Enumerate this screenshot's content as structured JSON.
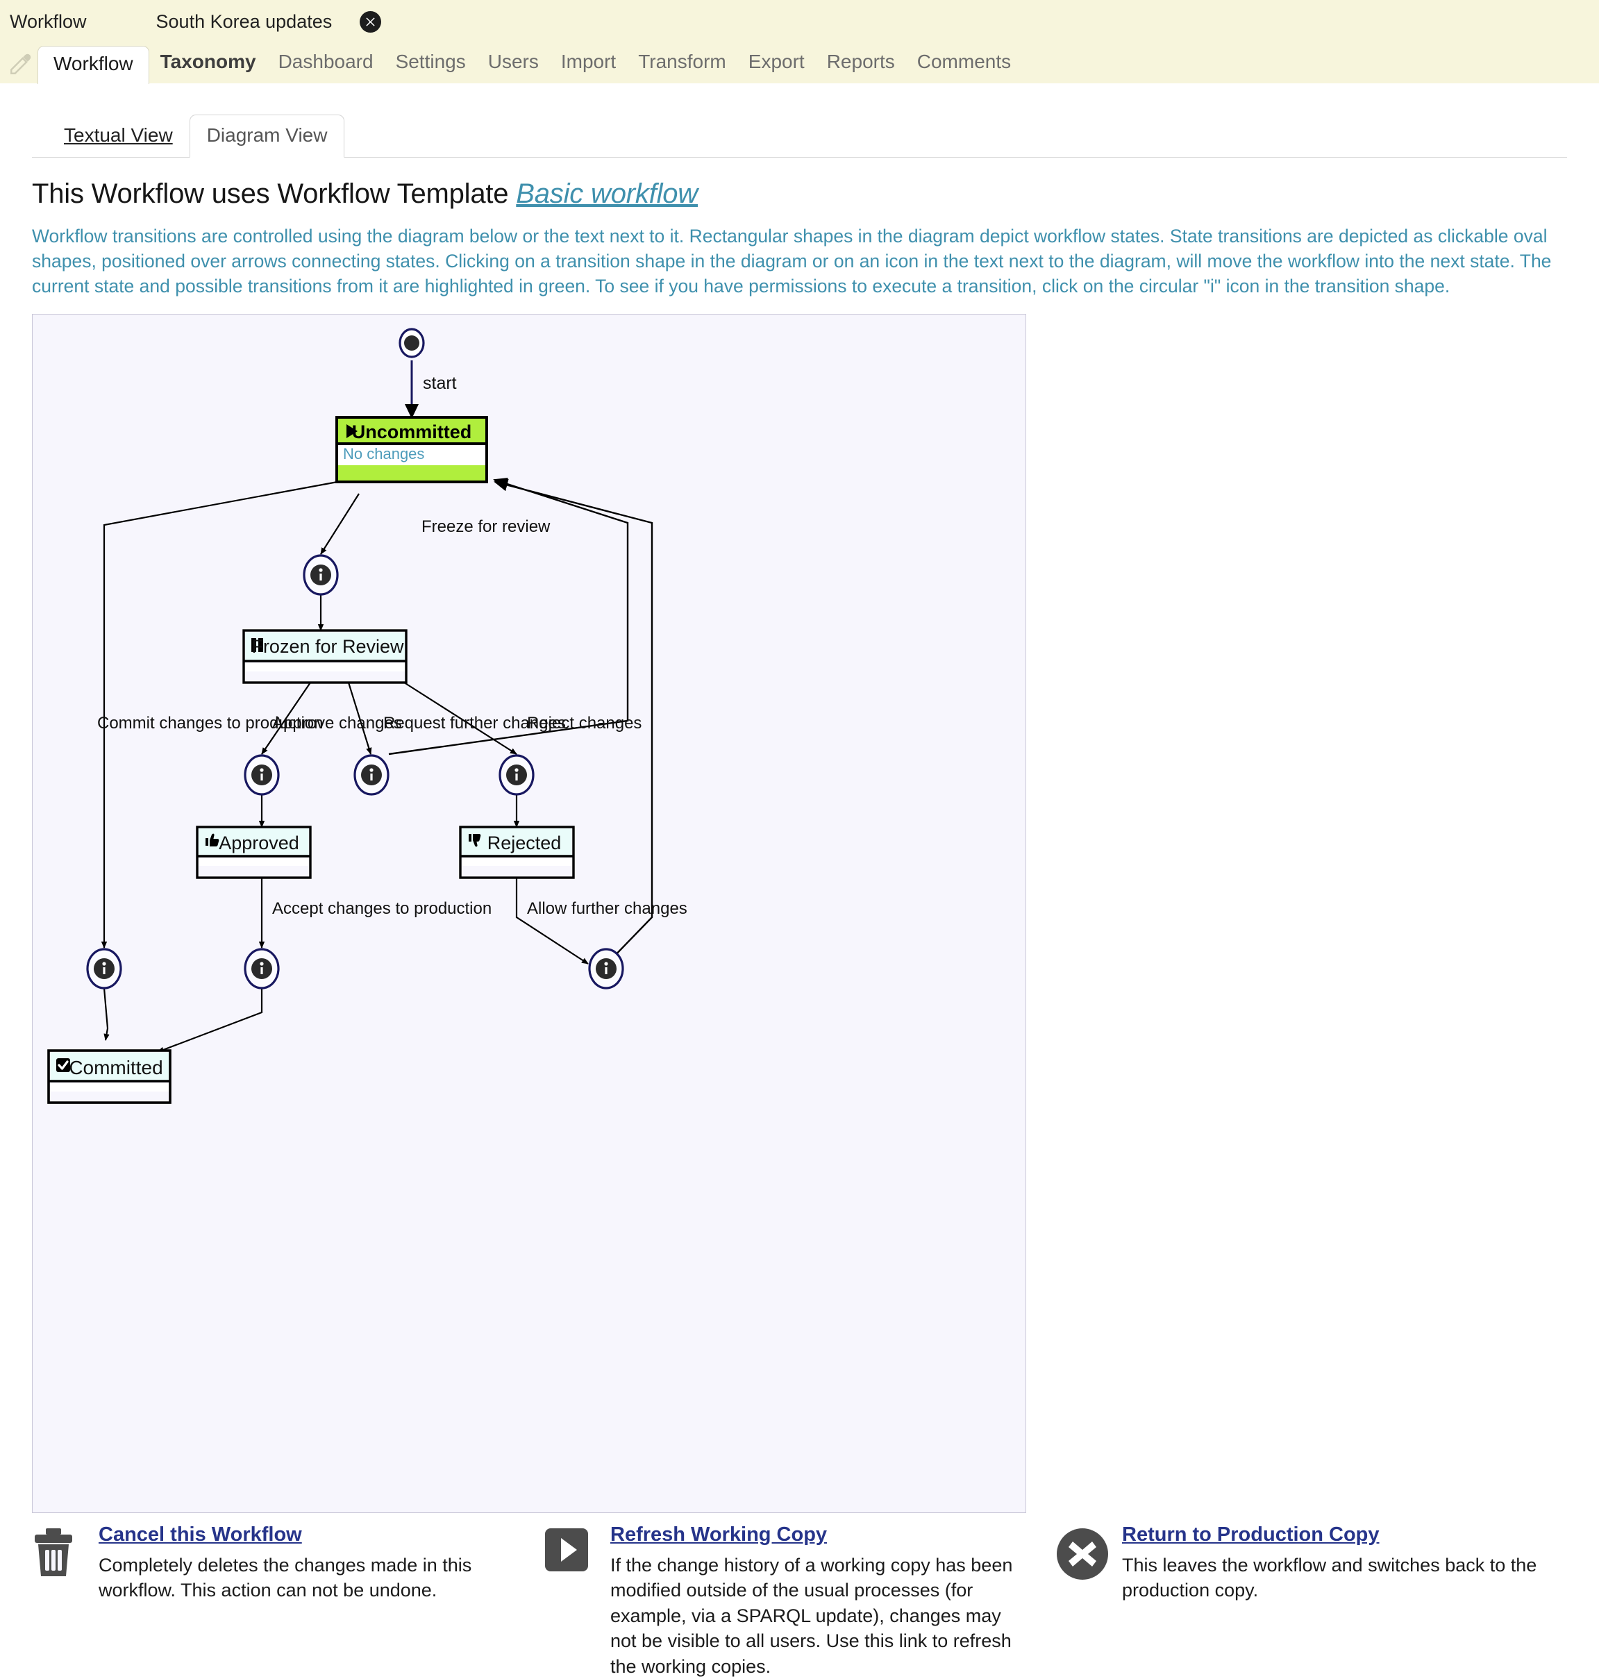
{
  "topbar": {
    "breadcrumb_app": "Workflow",
    "breadcrumb_item": "South Korea updates",
    "close_label": "✖"
  },
  "nav": {
    "active_tab": "Workflow",
    "items": [
      {
        "label": "Taxonomy",
        "bold": true
      },
      {
        "label": "Dashboard",
        "bold": false
      },
      {
        "label": "Settings",
        "bold": false
      },
      {
        "label": "Users",
        "bold": false
      },
      {
        "label": "Import",
        "bold": false
      },
      {
        "label": "Transform",
        "bold": false
      },
      {
        "label": "Export",
        "bold": false
      },
      {
        "label": "Reports",
        "bold": false
      },
      {
        "label": "Comments",
        "bold": false
      }
    ]
  },
  "view_tabs": {
    "textual": "Textual View",
    "diagram": "Diagram View"
  },
  "heading": {
    "prefix": "This Workflow uses Workflow Template ",
    "template_link": "Basic workflow"
  },
  "intro": "Workflow transitions are controlled using the diagram below or the text next to it. Rectangular shapes in the diagram depict workflow states. State transitions are depicted as clickable oval shapes, positioned over arrows connecting states. Clicking on a transition shape in the diagram or on an icon in the text next to the diagram, will move the workflow into the next state. The current state and possible transitions from it are highlighted in green. To see if you have permissions to execute a transition, click on the circular \"i\" icon in the transition shape.",
  "diagram": {
    "start_label": "start",
    "current_state": "Uncommitted",
    "highlight_color": "#b0ee3d",
    "state_color": "#eafcfa",
    "states": [
      {
        "id": "uncommitted",
        "title": "Uncommitted",
        "subtitle": "No changes",
        "icon": "play-icon",
        "current": true
      },
      {
        "id": "frozen",
        "title": "Frozen for Review",
        "subtitle": "",
        "icon": "pause-icon",
        "current": false
      },
      {
        "id": "approved",
        "title": "Approved",
        "subtitle": "",
        "icon": "thumbs-up-icon",
        "current": false
      },
      {
        "id": "rejected",
        "title": "Rejected",
        "subtitle": "",
        "icon": "thumbs-down-icon",
        "current": false
      },
      {
        "id": "committed",
        "title": "Committed",
        "subtitle": "",
        "icon": "check-box-icon",
        "current": false
      }
    ],
    "transitions": [
      {
        "id": "freeze",
        "label": "Freeze for review",
        "from": "uncommitted",
        "to": "frozen"
      },
      {
        "id": "commit",
        "label": "Commit changes to production",
        "from": "uncommitted",
        "to": "committed"
      },
      {
        "id": "approve",
        "label": "Approve changes",
        "from": "frozen",
        "to": "approved"
      },
      {
        "id": "request",
        "label": "Request further changes",
        "from": "frozen",
        "to": "uncommitted"
      },
      {
        "id": "reject",
        "label": "Reject changes",
        "from": "frozen",
        "to": "rejected"
      },
      {
        "id": "accept",
        "label": "Accept changes to production",
        "from": "approved",
        "to": "committed"
      },
      {
        "id": "allow",
        "label": "Allow further changes",
        "from": "rejected",
        "to": "uncommitted"
      }
    ]
  },
  "actions": [
    {
      "icon": "trash-icon",
      "link": "Cancel this Workflow",
      "desc": "Completely deletes the changes made in this workflow. This action can not be undone."
    },
    {
      "icon": "play-square-icon",
      "link": "Refresh Working Copy",
      "desc": "If the change history of a working copy has been modified outside of the usual processes (for example, via a SPARQL update), changes may not be visible to all users. Use this link to refresh the working copies."
    },
    {
      "icon": "close-circle-icon",
      "link": "Return to Production Copy",
      "desc": "This leaves the workflow and switches back to the production copy."
    }
  ]
}
